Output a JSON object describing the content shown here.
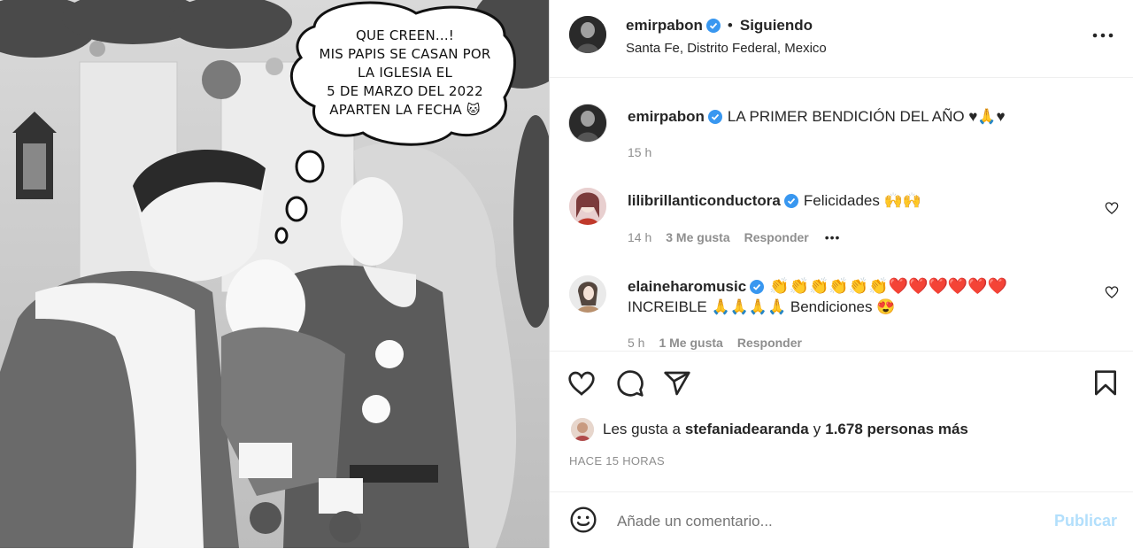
{
  "photo": {
    "bubble_lines": [
      "QUE CREEN...!",
      "MIS PAPIS SE CASAN POR",
      "LA IGLESIA EL",
      "5 DE MARZO DEL 2022",
      "APARTEN LA FECHA 🐱"
    ]
  },
  "header": {
    "username": "emirpabon",
    "separator": "•",
    "follow_status": "Siguiendo",
    "location": "Santa Fe, Distrito Federal, Mexico",
    "more_icon": "more-horizontal-icon"
  },
  "caption": {
    "username": "emirpabon",
    "text": "LA PRIMER BENDICIÓN DEL AÑO ♥🙏♥",
    "time": "15 h"
  },
  "comments": [
    {
      "username": "lilibrillanticonductora",
      "text": "Felicidades 🙌🙌",
      "time": "14 h",
      "likes": "3 Me gusta",
      "reply": "Responder",
      "more": "•••"
    },
    {
      "username": "elaineharomusic",
      "text_line1": "👏👏👏👏👏👏❤️❤️❤️❤️❤️❤️",
      "text_line2": "INCREIBLE 🙏🙏🙏🙏 Bendiciones 😍",
      "time": "5 h",
      "likes": "1 Me gusta",
      "reply": "Responder"
    }
  ],
  "actions": {
    "like_icon": "heart-icon",
    "comment_icon": "comment-icon",
    "share_icon": "share-icon",
    "save_icon": "bookmark-icon"
  },
  "likes": {
    "prefix": "Les gusta a",
    "user": "stefaniadearanda",
    "connector": "y",
    "count_text": "1.678 personas más"
  },
  "timestamp": "HACE 15 HORAS",
  "comment_box": {
    "emoji_icon": "emoji-icon",
    "placeholder": "Añade un comentario...",
    "publish": "Publicar"
  },
  "colors": {
    "verified": "#3897f0",
    "publish_disabled": "#b2dffc",
    "heart_red": "#ed4956"
  }
}
